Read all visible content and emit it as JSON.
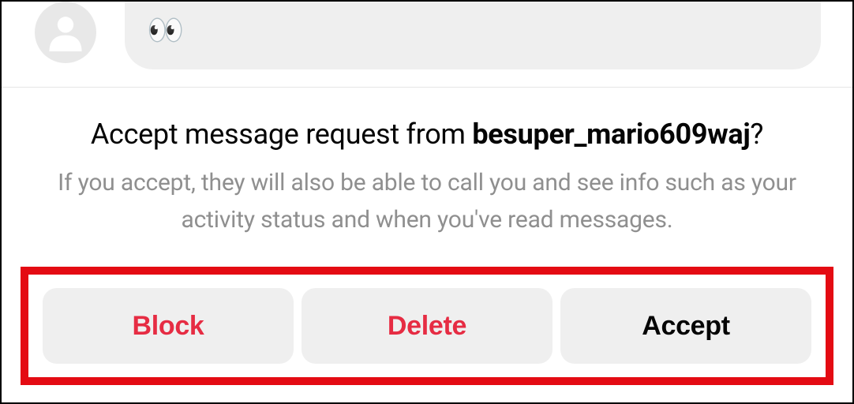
{
  "chat": {
    "message_emoji": "👀"
  },
  "prompt": {
    "heading_prefix": "Accept message request from ",
    "username": "besuper_mario609waj",
    "heading_suffix": "?",
    "subtext": "If you accept, they will also be able to call you and see info such as your activity status and when you've read messages."
  },
  "actions": {
    "block_label": "Block",
    "delete_label": "Delete",
    "accept_label": "Accept"
  },
  "colors": {
    "danger": "#e62c43",
    "highlight_border": "#e40b13",
    "bubble_bg": "#efefef"
  }
}
